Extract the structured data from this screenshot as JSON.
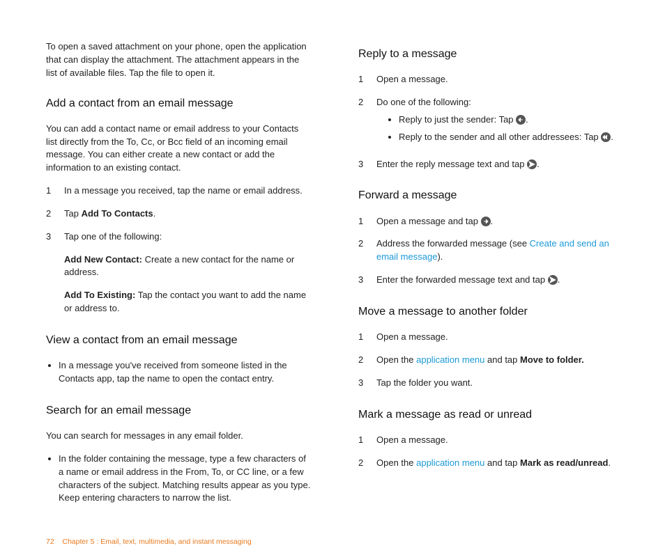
{
  "left": {
    "intro": "To open a saved attachment on your phone, open the application that can display the attachment. The attachment appears in the list of available files. Tap the file to open it.",
    "sec1": {
      "title": "Add a contact from an email message",
      "desc": "You can add a contact name or email address to your Contacts list directly from the To, Cc, or Bcc field of an incoming email message. You can either create a new contact or add the information to an existing contact.",
      "steps": {
        "s1": {
          "num": "1",
          "text": "In a message you received, tap the name or email address."
        },
        "s2": {
          "num": "2",
          "pre": "Tap ",
          "bold": "Add To Contacts",
          "post": "."
        },
        "s3": {
          "num": "3",
          "text": "Tap one of the following:",
          "opt1": {
            "bold": "Add New Contact:",
            "rest": " Create a new contact for the name or address."
          },
          "opt2": {
            "bold": "Add To Existing:",
            "rest": " Tap the contact you want to add the name or address to."
          }
        }
      }
    },
    "sec2": {
      "title": "View a contact from an email message",
      "bullet": "In a message you've received from someone listed in the Contacts app, tap the name to open the contact entry."
    },
    "sec3": {
      "title": "Search for an email message",
      "desc": "You can search for messages in any email folder.",
      "bullet": "In the folder containing the message, type a few characters of a name or email address in the From, To, or CC line, or a few characters of the subject. Matching results appear as you type. Keep entering characters to narrow the list."
    }
  },
  "right": {
    "reply": {
      "title": "Reply to a message",
      "s1": {
        "num": "1",
        "text": "Open a message."
      },
      "s2": {
        "num": "2",
        "text": "Do one of the following:",
        "sub1": {
          "pre": "Reply to just the sender: Tap ",
          "post": "."
        },
        "sub2": {
          "pre": "Reply to the sender and all other addressees: Tap ",
          "post": "."
        }
      },
      "s3": {
        "num": "3",
        "pre": "Enter the reply message text and tap ",
        "post": "."
      }
    },
    "forward": {
      "title": "Forward a message",
      "s1": {
        "num": "1",
        "pre": "Open a message and tap ",
        "post": "."
      },
      "s2": {
        "num": "2",
        "pre": "Address the forwarded message (see ",
        "link": "Create and send an email message",
        "post": ")."
      },
      "s3": {
        "num": "3",
        "pre": "Enter the forwarded message text and tap ",
        "post": "."
      }
    },
    "move": {
      "title": "Move a message to another folder",
      "s1": {
        "num": "1",
        "text": "Open a message."
      },
      "s2": {
        "num": "2",
        "pre": "Open the ",
        "link": "application menu",
        "mid": " and tap ",
        "bold": "Move to folder."
      },
      "s3": {
        "num": "3",
        "text": "Tap the folder you want."
      }
    },
    "mark": {
      "title": "Mark a message as read or unread",
      "s1": {
        "num": "1",
        "text": "Open a message."
      },
      "s2": {
        "num": "2",
        "pre": "Open the ",
        "link": "application menu",
        "mid": " and tap ",
        "bold": "Mark as read/unread",
        "post": "."
      }
    }
  },
  "footer": {
    "page": "72",
    "chapter": "Chapter 5 : Email, text, multimedia, and instant messaging"
  },
  "icons": {
    "reply": "reply-icon",
    "replyAll": "reply-all-icon",
    "forward": "forward-icon",
    "send": "send-icon"
  }
}
